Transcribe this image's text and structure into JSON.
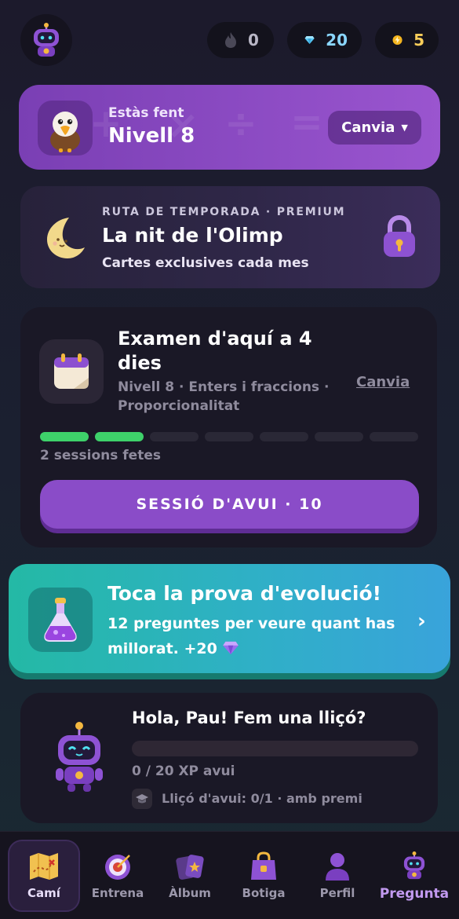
{
  "header": {
    "avatar_icon": "robot-icon",
    "streak": {
      "icon": "flame-icon",
      "value": "0"
    },
    "gems": {
      "icon": "gem-icon",
      "value": "20"
    },
    "energy": {
      "icon": "bolt-icon",
      "value": "5"
    }
  },
  "level_card": {
    "icon": "eagle-icon",
    "subtitle": "Estàs fent",
    "title": "Nivell 8",
    "change_label": "Canvia",
    "change_icon": "chevron-down-icon",
    "colors": {
      "accent": "#8b4cc4"
    }
  },
  "season_card": {
    "icon": "moon-icon",
    "subtitle": "RUTA DE TEMPORADA · PREMIUM",
    "title": "La nit de l'Olimp",
    "description": "Cartes exclusives cada mes",
    "lock_icon": "lock-icon"
  },
  "exam_card": {
    "icon": "calendar-icon",
    "title": "Examen d'aquí a 4 dies",
    "meta": "Nivell 8 · Enters i fraccions · Proporcionalitat",
    "change_label": "Canvia",
    "progress": {
      "done": 2,
      "total": 7
    },
    "sessions_text": "2 sessions fetes",
    "button_label": "SESSIÓ D'AVUI · 10",
    "colors": {
      "progress": "#3ed16a",
      "button": "#8a4cc8"
    }
  },
  "evolution_card": {
    "icon": "potion-flask-icon",
    "title": "Toca la prova d'evolució!",
    "description": "12 preguntes per veure quant has millorat. +20",
    "gem_icon": "gem-icon",
    "chevron_icon": "chevron-right-icon",
    "colors": {
      "from": "#24b9a5",
      "to": "#39a3db"
    }
  },
  "hello_card": {
    "icon": "robot-icon",
    "title": "Hola, Pau! Fem una lliçó?",
    "xp": {
      "current": 0,
      "goal": 20
    },
    "xp_text": "0 / 20 XP avui",
    "lesson_icon": "graduation-cap-icon",
    "lesson_text": "Lliçó d'avui: 0/1 · amb premi"
  },
  "nav": {
    "items": [
      {
        "label": "Camí",
        "icon": "treasure-map-icon",
        "active": true
      },
      {
        "label": "Entrena",
        "icon": "target-icon",
        "active": false
      },
      {
        "label": "Àlbum",
        "icon": "cards-icon",
        "active": false
      },
      {
        "label": "Botiga",
        "icon": "shopping-bag-icon",
        "active": false
      },
      {
        "label": "Perfil",
        "icon": "person-icon",
        "active": false
      },
      {
        "label": "Pregunta",
        "icon": "robot-icon",
        "active": false
      }
    ]
  }
}
